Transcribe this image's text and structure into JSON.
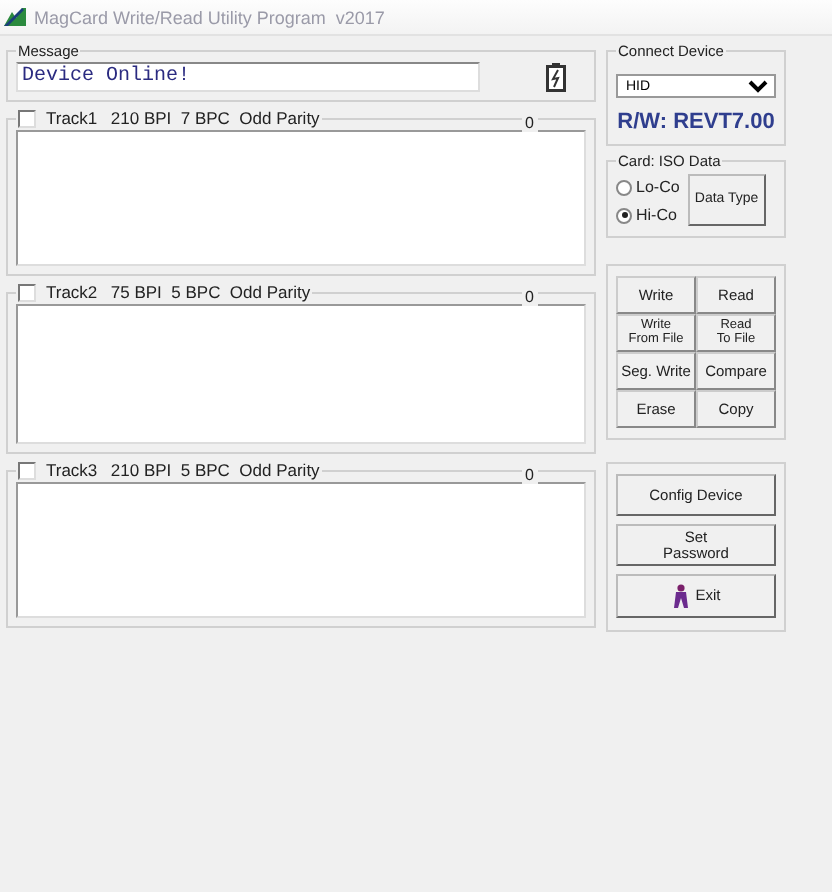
{
  "window": {
    "title": "MagCard Write/Read Utility Program  v2017"
  },
  "message": {
    "label": "Message",
    "value": "Device Online!"
  },
  "tracks": [
    {
      "label": "Track1",
      "format": "210 BPI  7 BPC  Odd Parity",
      "count": "0",
      "checked": false
    },
    {
      "label": "Track2",
      "format": "75 BPI  5 BPC  Odd Parity",
      "count": "0",
      "checked": false
    },
    {
      "label": "Track3",
      "format": "210 BPI  5 BPC  Odd Parity",
      "count": "0",
      "checked": false
    }
  ],
  "connect_device": {
    "label": "Connect Device",
    "device": "HID",
    "version": "R/W: REVT7.00"
  },
  "card_iso_data": {
    "label": "Card: ISO Data",
    "options": [
      {
        "label": "Lo-Co",
        "selected": false
      },
      {
        "label": "Hi-Co",
        "selected": true
      }
    ],
    "data_type_button": "Data Type"
  },
  "actions": [
    {
      "lines": [
        "Write"
      ]
    },
    {
      "lines": [
        "Read"
      ]
    },
    {
      "lines": [
        "Write",
        "From File"
      ]
    },
    {
      "lines": [
        "Read",
        "To File"
      ]
    },
    {
      "lines": [
        "Seg. Write"
      ]
    },
    {
      "lines": [
        "Compare"
      ]
    },
    {
      "lines": [
        "Erase"
      ]
    },
    {
      "lines": [
        "Copy"
      ]
    }
  ],
  "settings_buttons": [
    {
      "kind": "text",
      "lines": [
        "Config Device"
      ]
    },
    {
      "kind": "text",
      "lines": [
        "Set",
        "Password"
      ]
    },
    {
      "kind": "exit",
      "lines": [
        "Exit"
      ]
    }
  ]
}
